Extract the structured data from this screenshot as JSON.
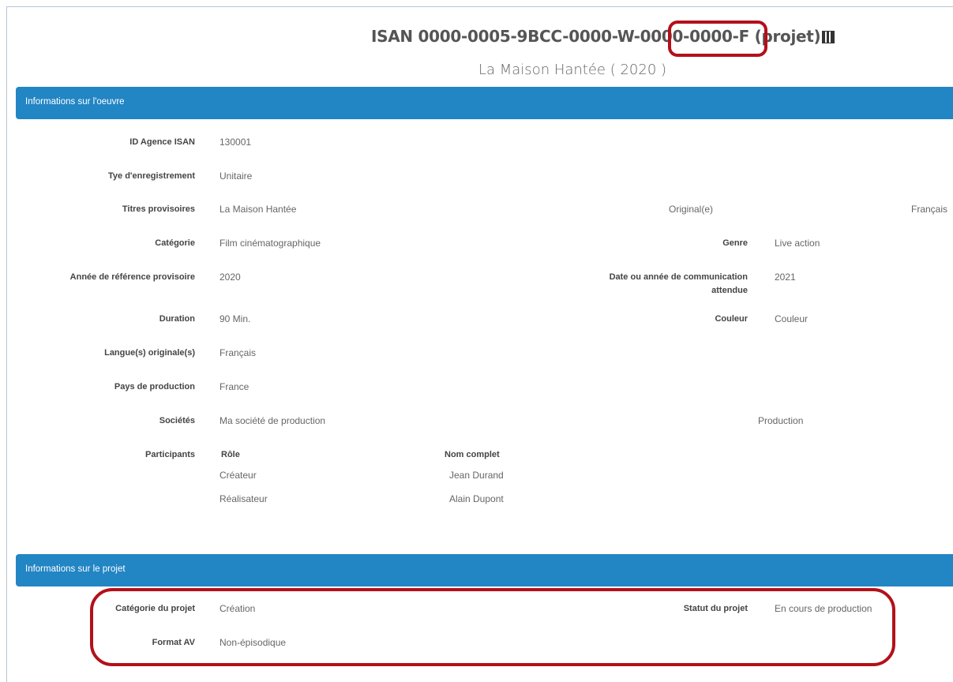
{
  "header": {
    "isan_title": "ISAN 0000-0005-9BCC-0000-W-0000-0000-F (projet)",
    "subtitle": "La Maison Hantée ( 2020 )"
  },
  "section_work": {
    "title": "Informations sur l'oeuvre",
    "fields": {
      "id_agence_label": "ID Agence ISAN",
      "id_agence_value": "130001",
      "type_label": "Tye d'enregistrement",
      "type_value": "Unitaire",
      "titres_label": "Titres provisoires",
      "titres_value": "La Maison Hantée",
      "titres_original": "Original(e)",
      "titres_langue": "Français",
      "categorie_label": "Catégorie",
      "categorie_value": "Film cinématographique",
      "genre_label": "Genre",
      "genre_value": "Live action",
      "annee_label": "Année de référence provisoire",
      "annee_value": "2020",
      "date_comm_label_1": "Date ou année de communication",
      "date_comm_label_2": "attendue",
      "date_comm_value": "2021",
      "duration_label": "Duration",
      "duration_value": "90 Min.",
      "couleur_label": "Couleur",
      "couleur_value": "Couleur",
      "langues_label": "Langue(s) originale(s)",
      "langues_value": "Français",
      "pays_label": "Pays de production",
      "pays_value": "France",
      "societes_label": "Sociétés",
      "societes_value": "Ma société de production",
      "societes_role": "Production",
      "participants_label": "Participants"
    },
    "participants": {
      "col_role": "Rôle",
      "col_nom": "Nom complet",
      "rows": [
        {
          "role": "Créateur",
          "nom": "Jean Durand"
        },
        {
          "role": "Réalisateur",
          "nom": "Alain Dupont"
        }
      ]
    }
  },
  "section_project": {
    "title": "Informations sur le projet",
    "fields": {
      "categorie_label": "Catégorie du projet",
      "categorie_value": "Création",
      "statut_label": "Statut du projet",
      "statut_value": "En cours de production",
      "format_label": "Format AV",
      "format_value": "Non-épisodique"
    }
  },
  "colors": {
    "section_bar": "#2285c4",
    "annotation": "#b3101a"
  }
}
